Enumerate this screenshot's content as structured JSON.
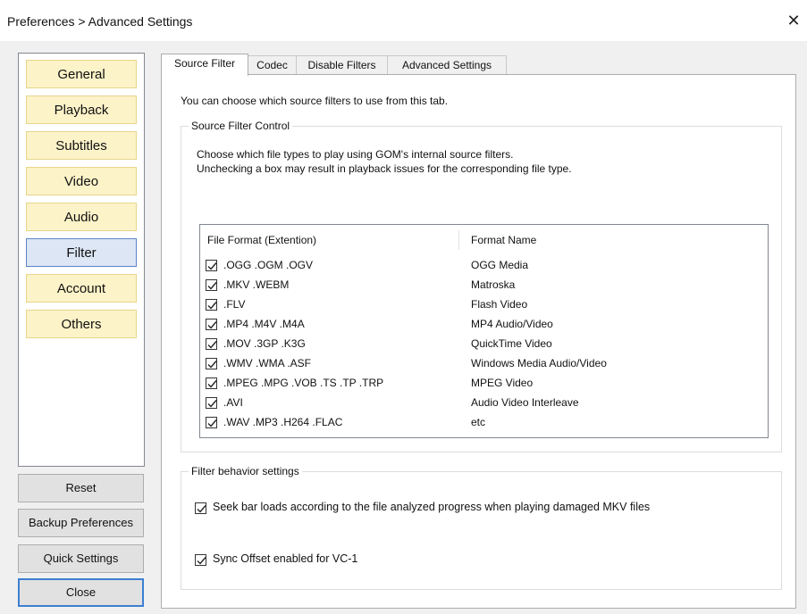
{
  "window": {
    "title": "Preferences > Advanced Settings",
    "close_glyph": "✕"
  },
  "sidebar": {
    "items": [
      {
        "label": "General"
      },
      {
        "label": "Playback"
      },
      {
        "label": "Subtitles"
      },
      {
        "label": "Video"
      },
      {
        "label": "Audio"
      },
      {
        "label": "Filter",
        "active": true
      },
      {
        "label": "Account"
      },
      {
        "label": "Others"
      }
    ]
  },
  "bottom_buttons": {
    "reset": "Reset",
    "backup": "Backup Preferences",
    "quick": "Quick Settings",
    "close": "Close"
  },
  "tabs": [
    {
      "label": "Source Filter",
      "active": true
    },
    {
      "label": "Codec"
    },
    {
      "label": "Disable Filters"
    },
    {
      "label": "Advanced Settings"
    }
  ],
  "source_filter": {
    "intro": "You can choose which source filters to use from this tab.",
    "control_group": {
      "legend": "Source Filter Control",
      "desc_line1": "Choose which file types to play using GOM's internal source filters.",
      "desc_line2": "Unchecking a box may result in playback issues for the corresponding file type."
    },
    "list": {
      "col_ext": "File Format (Extention)",
      "col_name": "Format Name",
      "rows": [
        {
          "ext": ".OGG .OGM .OGV",
          "name": "OGG Media",
          "checked": true
        },
        {
          "ext": ".MKV .WEBM",
          "name": "Matroska",
          "checked": true
        },
        {
          "ext": ".FLV",
          "name": "Flash Video",
          "checked": true
        },
        {
          "ext": ".MP4 .M4V .M4A",
          "name": "MP4 Audio/Video",
          "checked": true
        },
        {
          "ext": ".MOV .3GP .K3G",
          "name": "QuickTime Video",
          "checked": true
        },
        {
          "ext": ".WMV .WMA .ASF",
          "name": "Windows Media Audio/Video",
          "checked": true
        },
        {
          "ext": ".MPEG .MPG .VOB .TS .TP .TRP",
          "name": "MPEG Video",
          "checked": true
        },
        {
          "ext": ".AVI",
          "name": "Audio Video Interleave",
          "checked": true
        },
        {
          "ext": ".WAV .MP3 .H264 .FLAC",
          "name": "etc",
          "checked": true
        }
      ]
    },
    "behavior_group": {
      "legend": "Filter behavior settings",
      "options": [
        {
          "label": "Seek bar loads according to the file analyzed progress when playing damaged MKV files",
          "checked": true
        },
        {
          "label": "Sync Offset enabled for VC-1",
          "checked": true
        }
      ]
    }
  }
}
